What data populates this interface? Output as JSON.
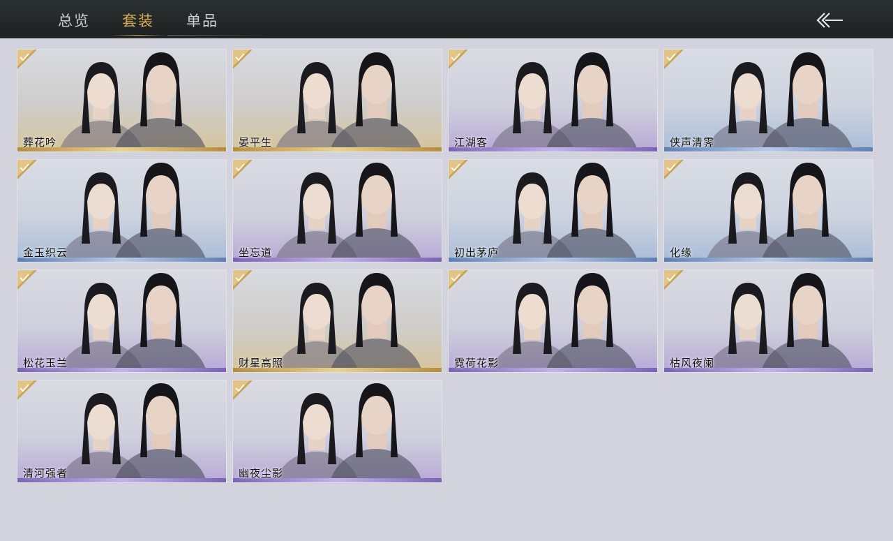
{
  "tabs": [
    {
      "label": "总览",
      "active": false
    },
    {
      "label": "套装",
      "active": true
    },
    {
      "label": "单品",
      "active": false
    }
  ],
  "back_icon": "double-chevron-back-icon",
  "colors": {
    "accent": "#d8a955",
    "topbar": "#1d2121",
    "background": "#d3d3de"
  },
  "outfits": [
    {
      "name": "葬花吟",
      "tier": "gold",
      "owned": true
    },
    {
      "name": "晏平生",
      "tier": "gold",
      "owned": true
    },
    {
      "name": "江湖客",
      "tier": "violet",
      "owned": true
    },
    {
      "name": "侠声清霁",
      "tier": "blue",
      "owned": true
    },
    {
      "name": "金玉织云",
      "tier": "blue",
      "owned": true
    },
    {
      "name": "坐忘道",
      "tier": "violet",
      "owned": true
    },
    {
      "name": "初出茅庐",
      "tier": "blue",
      "owned": true
    },
    {
      "name": "化缘",
      "tier": "blue",
      "owned": true
    },
    {
      "name": "松花玉兰",
      "tier": "violet",
      "owned": true
    },
    {
      "name": "财星高照",
      "tier": "gold",
      "owned": true
    },
    {
      "name": "霓荷花影",
      "tier": "violet",
      "owned": true
    },
    {
      "name": "枯风夜阑",
      "tier": "violet",
      "owned": true
    },
    {
      "name": "清河强者",
      "tier": "violet",
      "owned": true
    },
    {
      "name": "幽夜尘影",
      "tier": "violet",
      "owned": true
    }
  ]
}
